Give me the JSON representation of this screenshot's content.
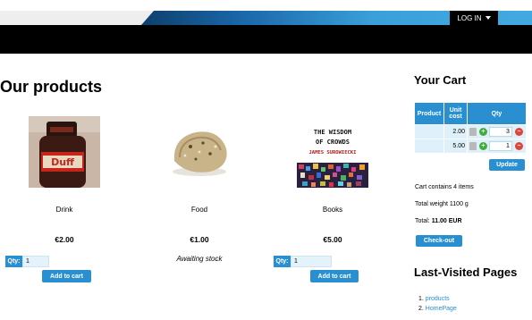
{
  "header": {
    "login_label": "LOG IN"
  },
  "main": {
    "heading": "Our products",
    "products": [
      {
        "name": "Drink",
        "price": "€2.00",
        "qty_label": "Qty:",
        "qty_value": "1",
        "add_label": "Add to cart"
      },
      {
        "name": "Food",
        "price": "€1.00",
        "stock_label": "Awaiting stock"
      },
      {
        "name": "Books",
        "price": "€5.00",
        "qty_label": "Qty:",
        "qty_value": "1",
        "add_label": "Add to cart",
        "cover_title": "THE WISDOM OF CROWDS",
        "cover_author": "JAMES SUROWIECKI"
      }
    ]
  },
  "cart": {
    "title": "Your Cart",
    "headers": {
      "product": "Product",
      "unit_cost": "Unit cost",
      "qty": "Qty"
    },
    "rows": [
      {
        "product": "",
        "unit_cost": "2.00",
        "qty": "3"
      },
      {
        "product": "",
        "unit_cost": "5.00",
        "qty": "1"
      }
    ],
    "update_label": "Update",
    "contains_text": "Cart contains 4 items",
    "weight_text": "Total weight 1100 g",
    "total_label": "Total:",
    "total_value": "11.00 EUR",
    "checkout_label": "Check-out"
  },
  "last_visited": {
    "title": "Last-Visited Pages",
    "items": [
      {
        "num": "1.",
        "label": "products"
      },
      {
        "num": "2.",
        "label": "HomePage"
      }
    ]
  }
}
